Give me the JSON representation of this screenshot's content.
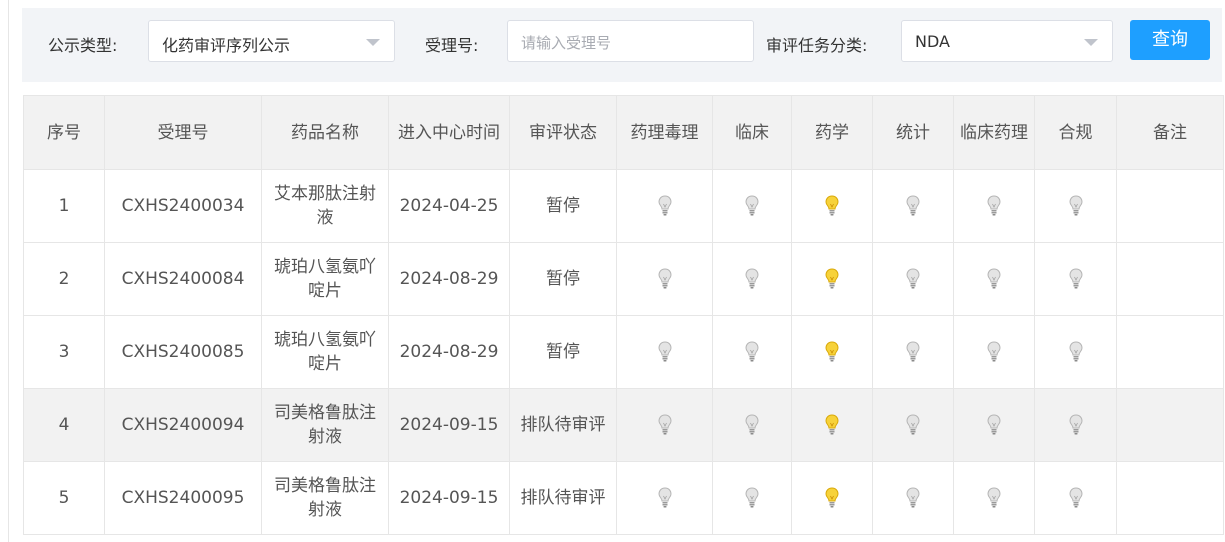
{
  "filter": {
    "type_label": "公示类型:",
    "type_value": "化药审评序列公示",
    "accept_label": "受理号:",
    "accept_placeholder": "请输入受理号",
    "category_label": "审评任务分类:",
    "category_value": "NDA",
    "search_label": "查询"
  },
  "table": {
    "headers": [
      "序号",
      "受理号",
      "药品名称",
      "进入中心时间",
      "审评状态",
      "药理毒理",
      "临床",
      "药学",
      "统计",
      "临床药理",
      "合规",
      "备注"
    ],
    "rows": [
      {
        "no": "1",
        "accept_no": "CXHS2400034",
        "drug": "艾本那肽注射液",
        "date": "2024-04-25",
        "status": "暂停",
        "bulbs": [
          "off",
          "off",
          "on",
          "off",
          "off",
          "off"
        ],
        "remark": ""
      },
      {
        "no": "2",
        "accept_no": "CXHS2400084",
        "drug": "琥珀八氢氨吖啶片",
        "date": "2024-08-29",
        "status": "暂停",
        "bulbs": [
          "off",
          "off",
          "on",
          "off",
          "off",
          "off"
        ],
        "remark": ""
      },
      {
        "no": "3",
        "accept_no": "CXHS2400085",
        "drug": "琥珀八氢氨吖啶片",
        "date": "2024-08-29",
        "status": "暂停",
        "bulbs": [
          "off",
          "off",
          "on",
          "off",
          "off",
          "off"
        ],
        "remark": ""
      },
      {
        "no": "4",
        "accept_no": "CXHS2400094",
        "drug": "司美格鲁肽注射液",
        "date": "2024-09-15",
        "status": "排队待审评",
        "bulbs": [
          "off",
          "off",
          "on",
          "off",
          "off",
          "off"
        ],
        "remark": ""
      },
      {
        "no": "5",
        "accept_no": "CXHS2400095",
        "drug": "司美格鲁肽注射液",
        "date": "2024-09-15",
        "status": "排队待审评",
        "bulbs": [
          "off",
          "off",
          "on",
          "off",
          "off",
          "off"
        ],
        "remark": ""
      }
    ]
  },
  "colors": {
    "bulb_on": "#f7d23a",
    "bulb_off": "#e4e4e4",
    "button": "#1e9fff"
  }
}
